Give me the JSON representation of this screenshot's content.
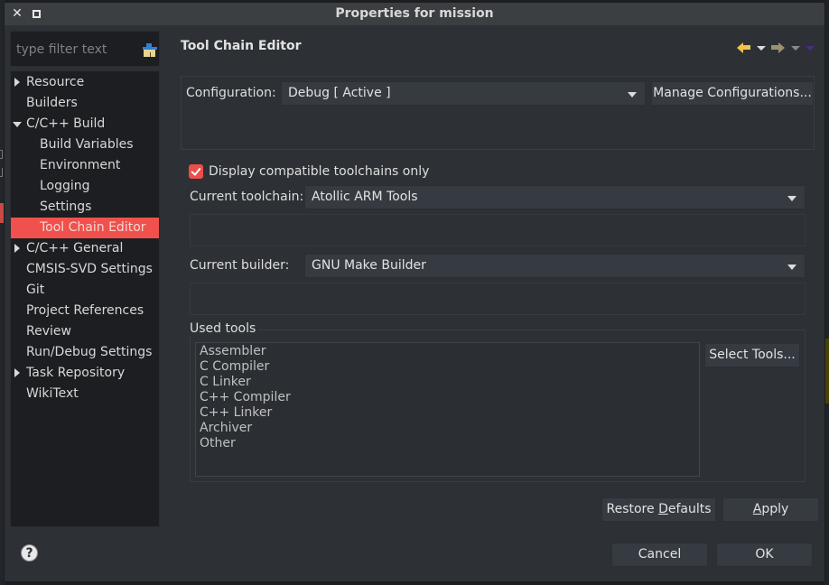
{
  "window": {
    "title": "Properties for mission"
  },
  "filter": {
    "placeholder": "type filter text",
    "value": ""
  },
  "tree": {
    "items": [
      {
        "label": "Resource",
        "level": 0,
        "expander": "collapsed"
      },
      {
        "label": "Builders",
        "level": 0,
        "expander": "none"
      },
      {
        "label": "C/C++ Build",
        "level": 0,
        "expander": "expanded"
      },
      {
        "label": "Build Variables",
        "level": 1,
        "expander": "none"
      },
      {
        "label": "Environment",
        "level": 1,
        "expander": "none"
      },
      {
        "label": "Logging",
        "level": 1,
        "expander": "none"
      },
      {
        "label": "Settings",
        "level": 1,
        "expander": "none"
      },
      {
        "label": "Tool Chain Editor",
        "level": 1,
        "expander": "none",
        "selected": true
      },
      {
        "label": "C/C++ General",
        "level": 0,
        "expander": "collapsed"
      },
      {
        "label": "CMSIS-SVD Settings",
        "level": 0,
        "expander": "none"
      },
      {
        "label": "Git",
        "level": 0,
        "expander": "none"
      },
      {
        "label": "Project References",
        "level": 0,
        "expander": "none"
      },
      {
        "label": "Review",
        "level": 0,
        "expander": "none"
      },
      {
        "label": "Run/Debug Settings",
        "level": 0,
        "expander": "none"
      },
      {
        "label": "Task Repository",
        "level": 0,
        "expander": "collapsed"
      },
      {
        "label": "WikiText",
        "level": 0,
        "expander": "none"
      }
    ]
  },
  "page": {
    "title": "Tool Chain Editor",
    "configuration_label": "Configuration:",
    "configuration_value": "Debug  [ Active ]",
    "manage_configurations": "Manage Configurations...",
    "display_compatible_label": "Display compatible toolchains only",
    "display_compatible_checked": true,
    "current_toolchain_label": "Current toolchain:",
    "current_toolchain_value": "Atollic ARM Tools",
    "current_builder_label": "Current builder:",
    "current_builder_value": "GNU Make Builder",
    "used_tools_label": "Used tools",
    "used_tools": [
      "Assembler",
      "C Compiler",
      "C Linker",
      "C++ Compiler",
      "C++ Linker",
      "Archiver",
      "Other"
    ],
    "select_tools": "Select Tools..."
  },
  "buttons": {
    "restore_defaults_pre": "Restore ",
    "restore_defaults_mn": "D",
    "restore_defaults_post": "efaults",
    "apply_mn": "A",
    "apply_post": "pply",
    "cancel": "Cancel",
    "ok": "OK"
  },
  "colors": {
    "accent": "#f0514c",
    "dialog_bg": "#2d3136",
    "tree_bg": "#1c1e21"
  }
}
